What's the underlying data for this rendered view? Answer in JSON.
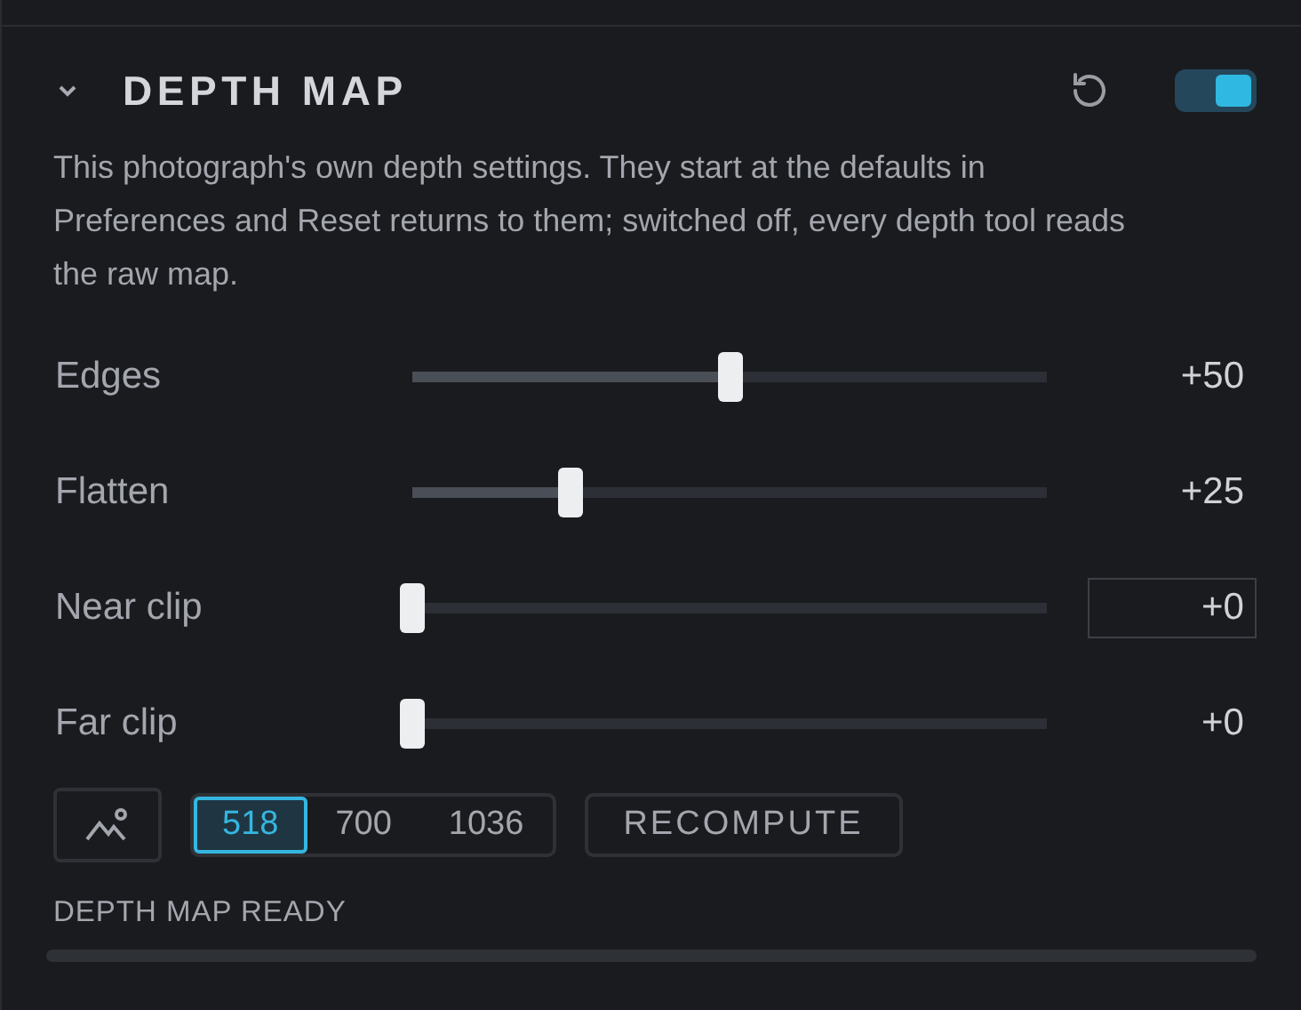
{
  "section": {
    "title": "DEPTH MAP",
    "expanded": true,
    "enabled": true,
    "description": "This photograph's own depth settings. They start at the defaults in Preferences and Reset returns to them; switched off, every depth tool reads the raw map."
  },
  "sliders": [
    {
      "label": "Edges",
      "level": 0.5,
      "reading": "+50",
      "editing": false
    },
    {
      "label": "Flatten",
      "level": 0.25,
      "reading": "+25",
      "editing": false
    },
    {
      "label": "Near clip",
      "level": 0,
      "reading": "+0",
      "editing": true
    },
    {
      "label": "Far clip",
      "level": 0,
      "reading": "+0",
      "editing": false
    }
  ],
  "resolutions": [
    {
      "label": "518",
      "selected": true
    },
    {
      "label": "700",
      "selected": false
    },
    {
      "label": "1036",
      "selected": false
    }
  ],
  "recompute_button": "RECOMPUTE",
  "status": {
    "text": "DEPTH MAP READY"
  }
}
